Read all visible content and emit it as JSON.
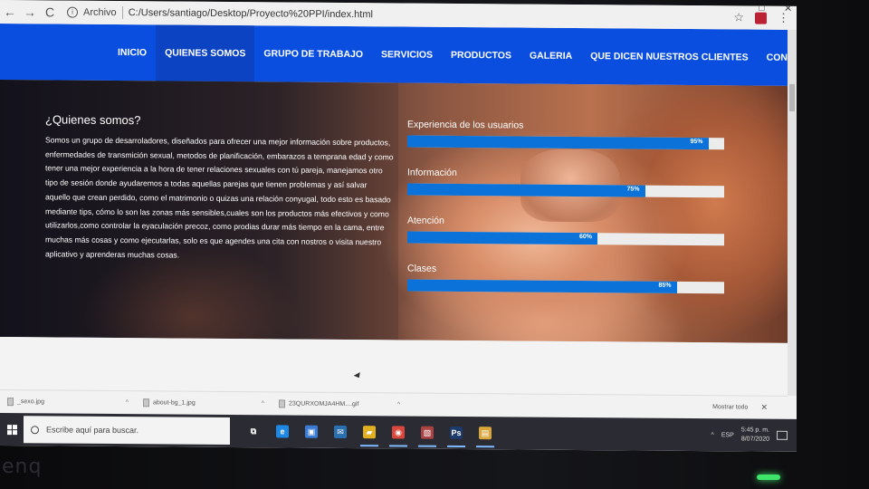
{
  "browser": {
    "scheme_label": "Archivo",
    "url": "C:/Users/santiago/Desktop/Proyecto%20PPI/index.html",
    "nav_back": "←",
    "nav_forward": "→",
    "nav_reload": "C",
    "info_glyph": "i",
    "bookmark_glyph": "☆",
    "menu_glyph": "⋮",
    "win_restore": "□",
    "win_close": "✕"
  },
  "navbar": {
    "items": [
      {
        "label": "INICIO",
        "active": true
      },
      {
        "label": "QUIENES SOMOS",
        "active": false
      },
      {
        "label": "GRUPO DE TRABAJO",
        "active": false
      },
      {
        "label": "SERVICIOS",
        "active": false
      },
      {
        "label": "PRODUCTOS",
        "active": false
      },
      {
        "label": "GALERIA",
        "active": false
      },
      {
        "label": "QUE DICEN NUESTROS CLIENTES",
        "active": false
      },
      {
        "label": "CONTACTO",
        "active": false
      }
    ],
    "color": "#0a4ee0"
  },
  "about": {
    "title": "¿Quienes somos?",
    "body": "Somos un grupo de desarroladores, diseñados para ofrecer una mejor información sobre productos, enfermedades de transmición sexual, metodos de planificación, embarazos a temprana edad y como tener una mejor experiencia a la hora de tener relaciones sexuales con tú pareja, manejamos otro tipo de sesión donde ayudaremos a todas aquellas parejas que tienen problemas y así salvar aquello que crean perdido, como el matrimonio o quizas una relación conyugal, todo esto es basado mediante tips, cómo lo son las zonas más sensibles,cuales son los productos más efectivos y como utilizarlos,como controlar la eyaculación precoz, como prodias durar más tiempo en la cama, entre muchas más cosas y como ejecutarlas, solo es que agendes una cita con nostros o visita nuestro aplicativo y aprenderas muchas cosas."
  },
  "skills": [
    {
      "label": "Experiencia de los usuarios",
      "percent": 95,
      "percent_label": "95%"
    },
    {
      "label": "Información",
      "percent": 75,
      "percent_label": "75%"
    },
    {
      "label": "Atención",
      "percent": 60,
      "percent_label": "60%"
    },
    {
      "label": "Clases",
      "percent": 85,
      "percent_label": "85%"
    }
  ],
  "skill_color": "#0a72d8",
  "downloads": {
    "items": [
      {
        "name": "_sexo.jpg"
      },
      {
        "name": "about-bg_1.jpg"
      },
      {
        "name": "23QURXOMJA4HM....gif"
      }
    ],
    "chevron": "^",
    "show_all": "Mostrar todo",
    "close_glyph": "✕"
  },
  "taskbar": {
    "search_placeholder": "Escribe aquí para buscar.",
    "apps": [
      {
        "name": "task-view",
        "glyph": "⧉",
        "color": "#2b2c33",
        "open": false
      },
      {
        "name": "edge",
        "glyph": "e",
        "color": "#1e88e5",
        "open": false
      },
      {
        "name": "store",
        "glyph": "▣",
        "color": "#3a7bd5",
        "open": false
      },
      {
        "name": "mail",
        "glyph": "✉",
        "color": "#2a6fb0",
        "open": false
      },
      {
        "name": "file-explorer",
        "glyph": "▰",
        "color": "#e0b020",
        "open": true
      },
      {
        "name": "chrome",
        "glyph": "◉",
        "color": "#d9463b",
        "open": true
      },
      {
        "name": "photos",
        "glyph": "▧",
        "color": "#a44",
        "open": true
      },
      {
        "name": "photoshop",
        "glyph": "Ps",
        "color": "#1c3a6b",
        "open": true
      },
      {
        "name": "files",
        "glyph": "▤",
        "color": "#d9a63b",
        "open": true
      }
    ],
    "language": "ESP",
    "time": "5:45 p. m.",
    "date": "8/07/2020",
    "tray_glyph": "^"
  },
  "monitor": {
    "brand": "enq"
  }
}
